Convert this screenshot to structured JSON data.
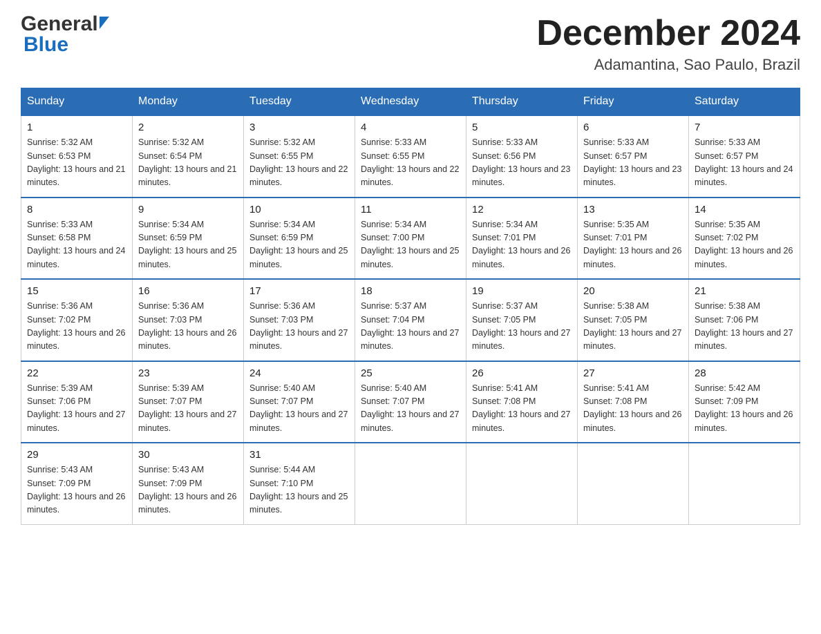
{
  "header": {
    "logo_general": "General",
    "logo_blue": "Blue",
    "title": "December 2024",
    "subtitle": "Adamantina, Sao Paulo, Brazil"
  },
  "days_of_week": [
    "Sunday",
    "Monday",
    "Tuesday",
    "Wednesday",
    "Thursday",
    "Friday",
    "Saturday"
  ],
  "weeks": [
    [
      {
        "day": "1",
        "sunrise": "5:32 AM",
        "sunset": "6:53 PM",
        "daylight": "13 hours and 21 minutes."
      },
      {
        "day": "2",
        "sunrise": "5:32 AM",
        "sunset": "6:54 PM",
        "daylight": "13 hours and 21 minutes."
      },
      {
        "day": "3",
        "sunrise": "5:32 AM",
        "sunset": "6:55 PM",
        "daylight": "13 hours and 22 minutes."
      },
      {
        "day": "4",
        "sunrise": "5:33 AM",
        "sunset": "6:55 PM",
        "daylight": "13 hours and 22 minutes."
      },
      {
        "day": "5",
        "sunrise": "5:33 AM",
        "sunset": "6:56 PM",
        "daylight": "13 hours and 23 minutes."
      },
      {
        "day": "6",
        "sunrise": "5:33 AM",
        "sunset": "6:57 PM",
        "daylight": "13 hours and 23 minutes."
      },
      {
        "day": "7",
        "sunrise": "5:33 AM",
        "sunset": "6:57 PM",
        "daylight": "13 hours and 24 minutes."
      }
    ],
    [
      {
        "day": "8",
        "sunrise": "5:33 AM",
        "sunset": "6:58 PM",
        "daylight": "13 hours and 24 minutes."
      },
      {
        "day": "9",
        "sunrise": "5:34 AM",
        "sunset": "6:59 PM",
        "daylight": "13 hours and 25 minutes."
      },
      {
        "day": "10",
        "sunrise": "5:34 AM",
        "sunset": "6:59 PM",
        "daylight": "13 hours and 25 minutes."
      },
      {
        "day": "11",
        "sunrise": "5:34 AM",
        "sunset": "7:00 PM",
        "daylight": "13 hours and 25 minutes."
      },
      {
        "day": "12",
        "sunrise": "5:34 AM",
        "sunset": "7:01 PM",
        "daylight": "13 hours and 26 minutes."
      },
      {
        "day": "13",
        "sunrise": "5:35 AM",
        "sunset": "7:01 PM",
        "daylight": "13 hours and 26 minutes."
      },
      {
        "day": "14",
        "sunrise": "5:35 AM",
        "sunset": "7:02 PM",
        "daylight": "13 hours and 26 minutes."
      }
    ],
    [
      {
        "day": "15",
        "sunrise": "5:36 AM",
        "sunset": "7:02 PM",
        "daylight": "13 hours and 26 minutes."
      },
      {
        "day": "16",
        "sunrise": "5:36 AM",
        "sunset": "7:03 PM",
        "daylight": "13 hours and 26 minutes."
      },
      {
        "day": "17",
        "sunrise": "5:36 AM",
        "sunset": "7:03 PM",
        "daylight": "13 hours and 27 minutes."
      },
      {
        "day": "18",
        "sunrise": "5:37 AM",
        "sunset": "7:04 PM",
        "daylight": "13 hours and 27 minutes."
      },
      {
        "day": "19",
        "sunrise": "5:37 AM",
        "sunset": "7:05 PM",
        "daylight": "13 hours and 27 minutes."
      },
      {
        "day": "20",
        "sunrise": "5:38 AM",
        "sunset": "7:05 PM",
        "daylight": "13 hours and 27 minutes."
      },
      {
        "day": "21",
        "sunrise": "5:38 AM",
        "sunset": "7:06 PM",
        "daylight": "13 hours and 27 minutes."
      }
    ],
    [
      {
        "day": "22",
        "sunrise": "5:39 AM",
        "sunset": "7:06 PM",
        "daylight": "13 hours and 27 minutes."
      },
      {
        "day": "23",
        "sunrise": "5:39 AM",
        "sunset": "7:07 PM",
        "daylight": "13 hours and 27 minutes."
      },
      {
        "day": "24",
        "sunrise": "5:40 AM",
        "sunset": "7:07 PM",
        "daylight": "13 hours and 27 minutes."
      },
      {
        "day": "25",
        "sunrise": "5:40 AM",
        "sunset": "7:07 PM",
        "daylight": "13 hours and 27 minutes."
      },
      {
        "day": "26",
        "sunrise": "5:41 AM",
        "sunset": "7:08 PM",
        "daylight": "13 hours and 27 minutes."
      },
      {
        "day": "27",
        "sunrise": "5:41 AM",
        "sunset": "7:08 PM",
        "daylight": "13 hours and 26 minutes."
      },
      {
        "day": "28",
        "sunrise": "5:42 AM",
        "sunset": "7:09 PM",
        "daylight": "13 hours and 26 minutes."
      }
    ],
    [
      {
        "day": "29",
        "sunrise": "5:43 AM",
        "sunset": "7:09 PM",
        "daylight": "13 hours and 26 minutes."
      },
      {
        "day": "30",
        "sunrise": "5:43 AM",
        "sunset": "7:09 PM",
        "daylight": "13 hours and 26 minutes."
      },
      {
        "day": "31",
        "sunrise": "5:44 AM",
        "sunset": "7:10 PM",
        "daylight": "13 hours and 25 minutes."
      },
      null,
      null,
      null,
      null
    ]
  ]
}
